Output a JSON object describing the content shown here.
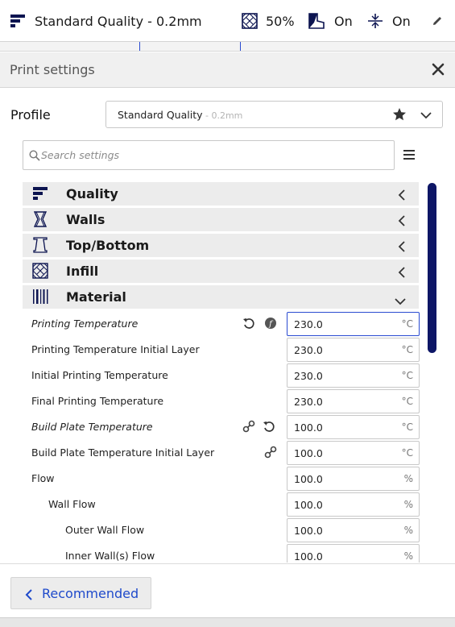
{
  "topbar": {
    "profile_name": "Standard Quality - 0.2mm",
    "infill_value": "50%",
    "support_value": "On",
    "adhesion_value": "On"
  },
  "panel": {
    "title": "Print settings"
  },
  "profile": {
    "label": "Profile",
    "name": "Standard Quality",
    "sub": " - 0.2mm"
  },
  "search": {
    "placeholder": "Search settings"
  },
  "categories": [
    {
      "label": "Quality",
      "icon": "quality-icon",
      "expanded": false
    },
    {
      "label": "Walls",
      "icon": "walls-icon",
      "expanded": false
    },
    {
      "label": "Top/Bottom",
      "icon": "top-bottom-icon",
      "expanded": false
    },
    {
      "label": "Infill",
      "icon": "infill-icon",
      "expanded": false
    },
    {
      "label": "Material",
      "icon": "material-icon",
      "expanded": true
    }
  ],
  "settings": [
    {
      "label": "Printing Temperature",
      "value": "230.0",
      "unit": "°C"
    },
    {
      "label": "Printing Temperature Initial Layer",
      "value": "230.0",
      "unit": "°C"
    },
    {
      "label": "Initial Printing Temperature",
      "value": "230.0",
      "unit": "°C"
    },
    {
      "label": "Final Printing Temperature",
      "value": "230.0",
      "unit": "°C"
    },
    {
      "label": "Build Plate Temperature",
      "value": "100.0",
      "unit": "°C"
    },
    {
      "label": "Build Plate Temperature Initial Layer",
      "value": "100.0",
      "unit": "°C"
    },
    {
      "label": "Flow",
      "value": "100.0",
      "unit": "%"
    },
    {
      "label": "Wall Flow",
      "value": "100.0",
      "unit": "%"
    },
    {
      "label": "Outer Wall Flow",
      "value": "100.0",
      "unit": "%"
    },
    {
      "label": "Inner Wall(s) Flow",
      "value": "100.0",
      "unit": "%"
    }
  ],
  "footer": {
    "recommended_label": "Recommended"
  },
  "colors": {
    "accent": "#1f4acb",
    "scrollbar": "#0d1666"
  }
}
